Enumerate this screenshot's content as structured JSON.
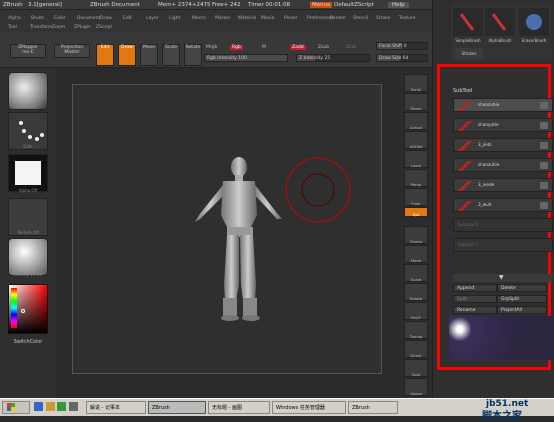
{
  "titlebar": {
    "app": "ZBrush",
    "version": "3.1[general]",
    "doc": "ZBrush Document",
    "mem": "Mem+ 2374+2475",
    "free": "Free+ 242",
    "timer": "Timer 00:01:08",
    "menus": "Menus",
    "script": "DefaultZScript",
    "help": "Help"
  },
  "menubar": {
    "row1": [
      "Alpha",
      "Brush",
      "Color",
      "Document",
      "Draw",
      "Edit",
      "Layer",
      "Light",
      "Macro",
      "Marker",
      "Material",
      "Movie",
      "Picker",
      "Preferences",
      "Render",
      "Stencil",
      "Stroke",
      "Texture"
    ],
    "row2": [
      "Tool",
      "Transform",
      "Zoom",
      "ZPlugin",
      "ZScript"
    ]
  },
  "toolbar": {
    "zmapper": "ZMapper",
    "zmapper_sub": "rev-E",
    "projection": "Projection",
    "projection_sub": "Master",
    "buttons": [
      "Edit",
      "Draw",
      "Move",
      "Scale",
      "Rotate"
    ],
    "mrgb": "Mrgb",
    "rgb": "Rgb",
    "m": "M",
    "zadd": "Zadd",
    "zsub": "Zsub",
    "zcut": "Zcut",
    "rgb_intensity": "Rgb Intensity 100",
    "z_intensity": "Z Intensity 25",
    "focal_shift": "Focal Shift 0",
    "draw_size": "Draw Size 64"
  },
  "leftshelf": {
    "items": [
      "Standard",
      "Dots",
      "Alpha Off",
      "Texture Off",
      "MatCap White"
    ],
    "switch_color": "SwitchColor"
  },
  "rightshelf": {
    "items": [
      "Scroll",
      "Zoom",
      "Actual",
      "AAHalf",
      "Local",
      "Persp",
      "Floor",
      "Xyz",
      "Frame",
      "Move",
      "Scale",
      "Rotate",
      "PolyF",
      "Transp",
      "Ghost",
      "Solo",
      "Xpose"
    ]
  },
  "tray": {
    "brushes": [
      "SimpleBrush",
      "AlphaBrush",
      "EraserBrush",
      "Strokes"
    ],
    "subtool_title": "SubTool",
    "subtools": [
      "shanzuhie",
      "shanyutie",
      "3_jiedi",
      "shanzuhie",
      "3_xiede",
      "3_wuh"
    ],
    "empty_slots": [
      "Subtool 6",
      "Subtool 7"
    ],
    "buttons": [
      "Append",
      "Delete",
      "Split",
      "GrpSplit",
      "Rename",
      "ProjectAll"
    ]
  },
  "taskbar": {
    "items": [
      "解说 - 记事本",
      "ZBrush",
      "无标题 - 画图",
      "Windows 任务管理器",
      "ZBrush"
    ],
    "watermark_site": "jb51.net",
    "watermark_cn": "脚本之家"
  },
  "colors": {
    "accent": "#e07a10",
    "highlight_box": "#ff0000",
    "menus_btn": "#c8500f"
  }
}
